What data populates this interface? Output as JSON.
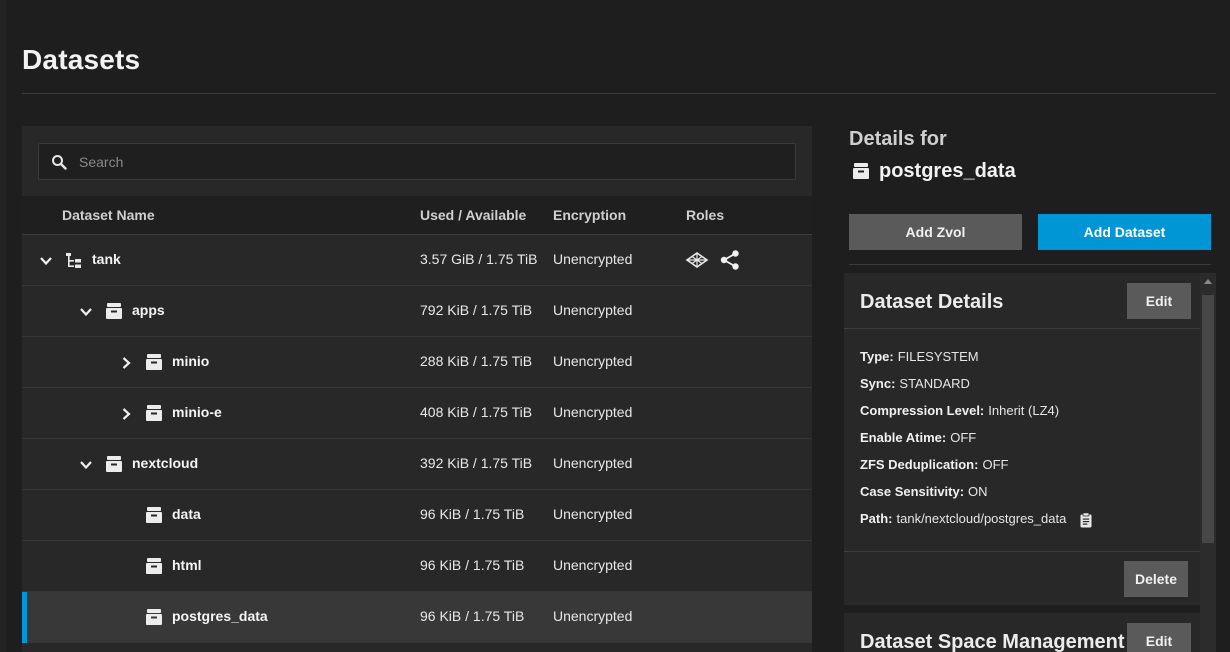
{
  "page": {
    "title": "Datasets"
  },
  "search": {
    "placeholder": "Search"
  },
  "table": {
    "headers": {
      "name": "Dataset Name",
      "used": "Used / Available",
      "encryption": "Encryption",
      "roles": "Roles"
    },
    "rows": [
      {
        "name": "tank",
        "used": "3.57 GiB / 1.75 TiB",
        "encryption": "Unencrypted",
        "expander": "chevron-down",
        "icon": "pool-tree-icon",
        "roles": [
          "apps-role-icon",
          "share-icon"
        ]
      },
      {
        "name": "apps",
        "used": "792 KiB / 1.75 TiB",
        "encryption": "Unencrypted",
        "expander": "chevron-down",
        "icon": "dataset-icon"
      },
      {
        "name": "minio",
        "used": "288 KiB / 1.75 TiB",
        "encryption": "Unencrypted",
        "expander": "chevron-right",
        "icon": "dataset-icon"
      },
      {
        "name": "minio-e",
        "used": "408 KiB / 1.75 TiB",
        "encryption": "Unencrypted",
        "expander": "chevron-right",
        "icon": "dataset-icon"
      },
      {
        "name": "nextcloud",
        "used": "392 KiB / 1.75 TiB",
        "encryption": "Unencrypted",
        "expander": "chevron-down",
        "icon": "dataset-icon"
      },
      {
        "name": "data",
        "used": "96 KiB / 1.75 TiB",
        "encryption": "Unencrypted",
        "icon": "dataset-icon"
      },
      {
        "name": "html",
        "used": "96 KiB / 1.75 TiB",
        "encryption": "Unencrypted",
        "icon": "dataset-icon"
      },
      {
        "name": "postgres_data",
        "used": "96 KiB / 1.75 TiB",
        "encryption": "Unencrypted",
        "icon": "dataset-icon",
        "selected": true
      }
    ]
  },
  "details": {
    "heading": "Details for",
    "dataset_name": "postgres_data",
    "add_zvol_label": "Add Zvol",
    "add_dataset_label": "Add Dataset",
    "dataset_details": {
      "title": "Dataset Details",
      "edit_label": "Edit",
      "delete_label": "Delete",
      "fields": [
        {
          "key": "Type:",
          "value": "FILESYSTEM"
        },
        {
          "key": "Sync:",
          "value": "STANDARD"
        },
        {
          "key": "Compression Level:",
          "value": "Inherit (LZ4)"
        },
        {
          "key": "Enable Atime:",
          "value": "OFF"
        },
        {
          "key": "ZFS Deduplication:",
          "value": "OFF"
        },
        {
          "key": "Case Sensitivity:",
          "value": "ON"
        },
        {
          "key": "Path:",
          "value": "tank/nextcloud/postgres_data"
        }
      ]
    },
    "space_management": {
      "title": "Dataset Space Management",
      "edit_label": "Edit"
    }
  },
  "colors": {
    "accent": "#0095d5",
    "background": "#1e1e1e",
    "panel": "#282828",
    "button_secondary": "#5a5a5a"
  }
}
